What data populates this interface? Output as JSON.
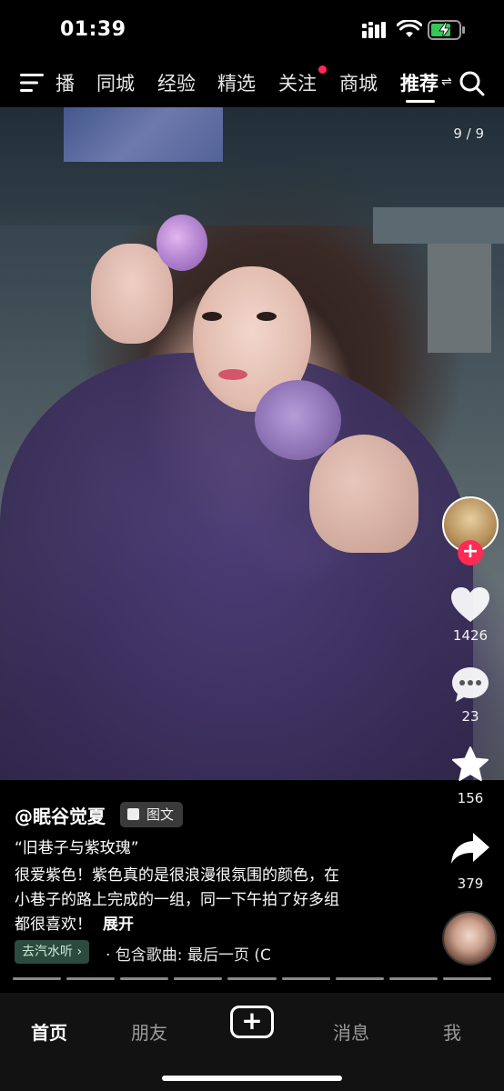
{
  "status_bar": {
    "time": "01:39"
  },
  "top_nav": {
    "tabs": [
      {
        "label": "播",
        "active": false
      },
      {
        "label": "同城",
        "active": false
      },
      {
        "label": "经验",
        "active": false
      },
      {
        "label": "精选",
        "active": false
      },
      {
        "label": "关注",
        "active": false,
        "has_dot": true
      },
      {
        "label": "商城",
        "active": false
      },
      {
        "label": "推荐",
        "active": true
      }
    ],
    "switch_icon": "⇌"
  },
  "post": {
    "photo_counter": "9 / 9",
    "author": "@眠谷觉夏",
    "type_badge": "图文",
    "title": "“旧巷子与紫玫瑰”",
    "desc_lines": [
      "很爱紫色！紫色真的是很浪漫很氛围的颜色，在",
      "小巷子的路上完成的一组，同一下午拍了好多组",
      "都很喜欢！"
    ],
    "expand_label": "展开",
    "source_tag": "去汽水听 ›",
    "music_text": "· 包含歌曲: 最后一页 (C",
    "total_images": 9,
    "current_image": 9
  },
  "actions": {
    "like_count": "1426",
    "comment_count": "23",
    "favorite_count": "156",
    "share_count": "379",
    "follow_symbol": "+"
  },
  "bottom_nav": {
    "tabs": [
      {
        "label": "首页",
        "active": true
      },
      {
        "label": "朋友",
        "active": false
      },
      {
        "label": "消息",
        "active": false
      },
      {
        "label": "我",
        "active": false
      }
    ],
    "plus_symbol": "+"
  },
  "colors": {
    "accent_red": "#ff2b54",
    "source_tag_bg": "#2c4a3d",
    "bottom_bar_bg": "#121212"
  }
}
